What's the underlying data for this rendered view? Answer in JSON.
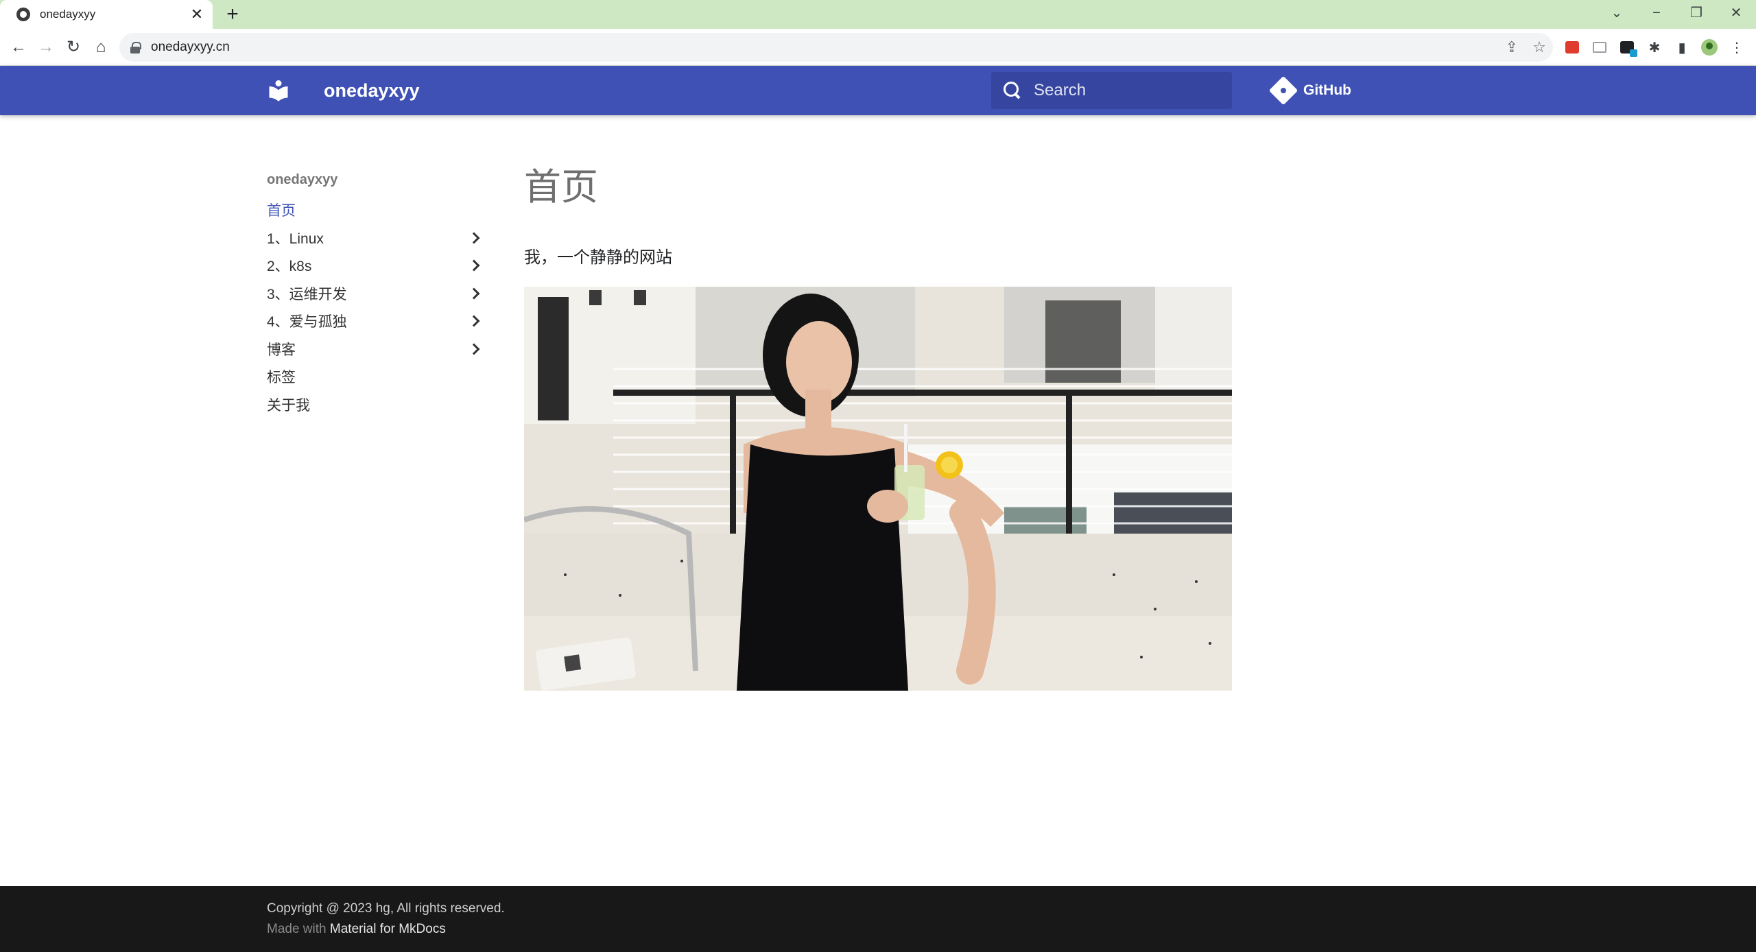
{
  "browser": {
    "tab_title": "onedayxyy",
    "url": "onedayxyy.cn"
  },
  "header": {
    "site_name": "onedayxyy",
    "search_placeholder": "Search",
    "repo_label": "GitHub"
  },
  "sidebar": {
    "title": "onedayxyy",
    "items": [
      {
        "label": "首页",
        "active": true,
        "expandable": false
      },
      {
        "label": "1、Linux",
        "active": false,
        "expandable": true
      },
      {
        "label": "2、k8s",
        "active": false,
        "expandable": true
      },
      {
        "label": "3、运维开发",
        "active": false,
        "expandable": true
      },
      {
        "label": "4、爱与孤独",
        "active": false,
        "expandable": true
      },
      {
        "label": "博客",
        "active": false,
        "expandable": true
      },
      {
        "label": "标签",
        "active": false,
        "expandable": false
      },
      {
        "label": "关于我",
        "active": false,
        "expandable": false
      }
    ]
  },
  "main": {
    "title": "首页",
    "intro": "我，一个静静的网站"
  },
  "footer": {
    "copyright": "Copyright @ 2023 hg, All rights reserved.",
    "made_with_prefix": "Made with",
    "made_with_link": "Material for MkDocs"
  },
  "colors": {
    "primary": "#3f51b5",
    "tabstrip": "#cde8c3",
    "footer": "#181818",
    "active_link": "#3f51b5"
  },
  "icons": {
    "logo": "book-open-icon",
    "search": "search-icon",
    "repo": "git-icon",
    "chevron": "chevron-right-icon"
  }
}
